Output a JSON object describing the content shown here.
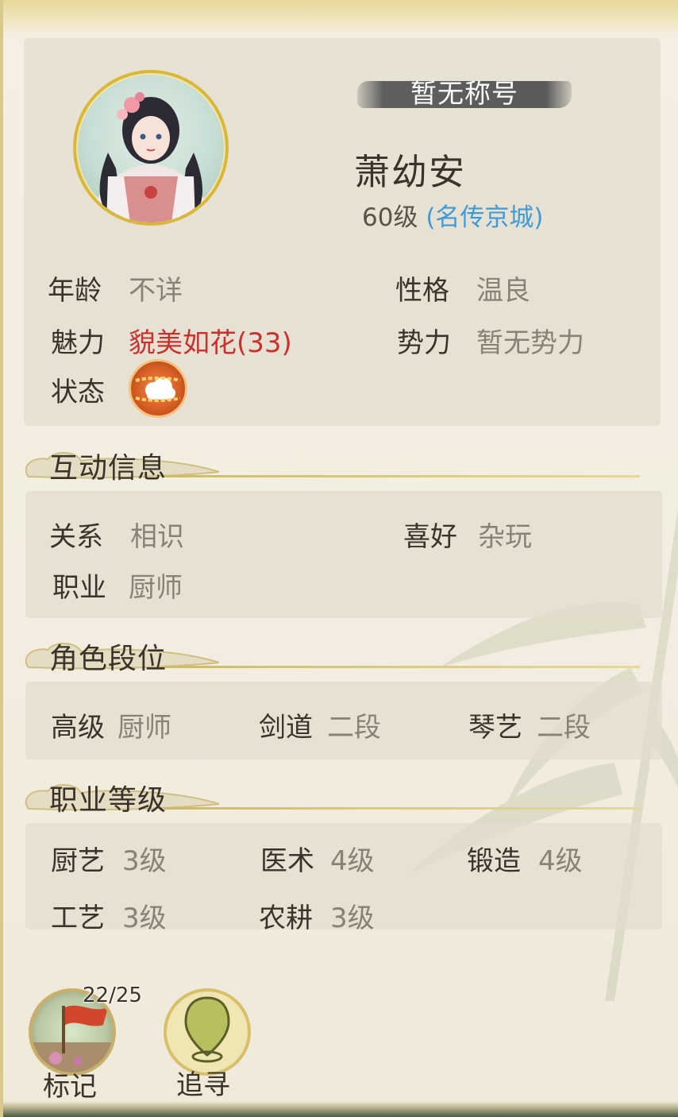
{
  "profile": {
    "title_badge": "暂无称号",
    "name": "萧幼安",
    "level": "60级",
    "fame": "(名传京城)",
    "fields": {
      "age_label": "年龄",
      "age_value": "不详",
      "personality_label": "性格",
      "personality_value": "温良",
      "charm_label": "魅力",
      "charm_value": "貌美如花(33)",
      "faction_label": "势力",
      "faction_value": "暂无势力",
      "status_label": "状态"
    },
    "status_icon": "chained-cloud-icon"
  },
  "interaction": {
    "heading": "互动信息",
    "relation_label": "关系",
    "relation_value": "相识",
    "hobby_label": "喜好",
    "hobby_value": "杂玩",
    "job_label": "职业",
    "job_value": "厨师"
  },
  "rank": {
    "heading": "角色段位",
    "items": [
      {
        "label": "高级",
        "value": "厨师"
      },
      {
        "label": "剑道",
        "value": "二段"
      },
      {
        "label": "琴艺",
        "value": "二段"
      }
    ]
  },
  "job_level": {
    "heading": "职业等级",
    "items": [
      {
        "label": "厨艺",
        "value": "3级"
      },
      {
        "label": "医术",
        "value": "4级"
      },
      {
        "label": "锻造",
        "value": "4级"
      },
      {
        "label": "工艺",
        "value": "3级"
      },
      {
        "label": "农耕",
        "value": "3级"
      }
    ]
  },
  "actions": {
    "mark_label": "标记",
    "mark_count": "22/25",
    "track_label": "追寻",
    "mark_icon": "flag-icon",
    "track_icon": "location-pin-icon"
  },
  "colors": {
    "accent_gold": "#d9b73a",
    "fame_blue": "#3e9bd6",
    "charm_red": "#c8322e"
  }
}
